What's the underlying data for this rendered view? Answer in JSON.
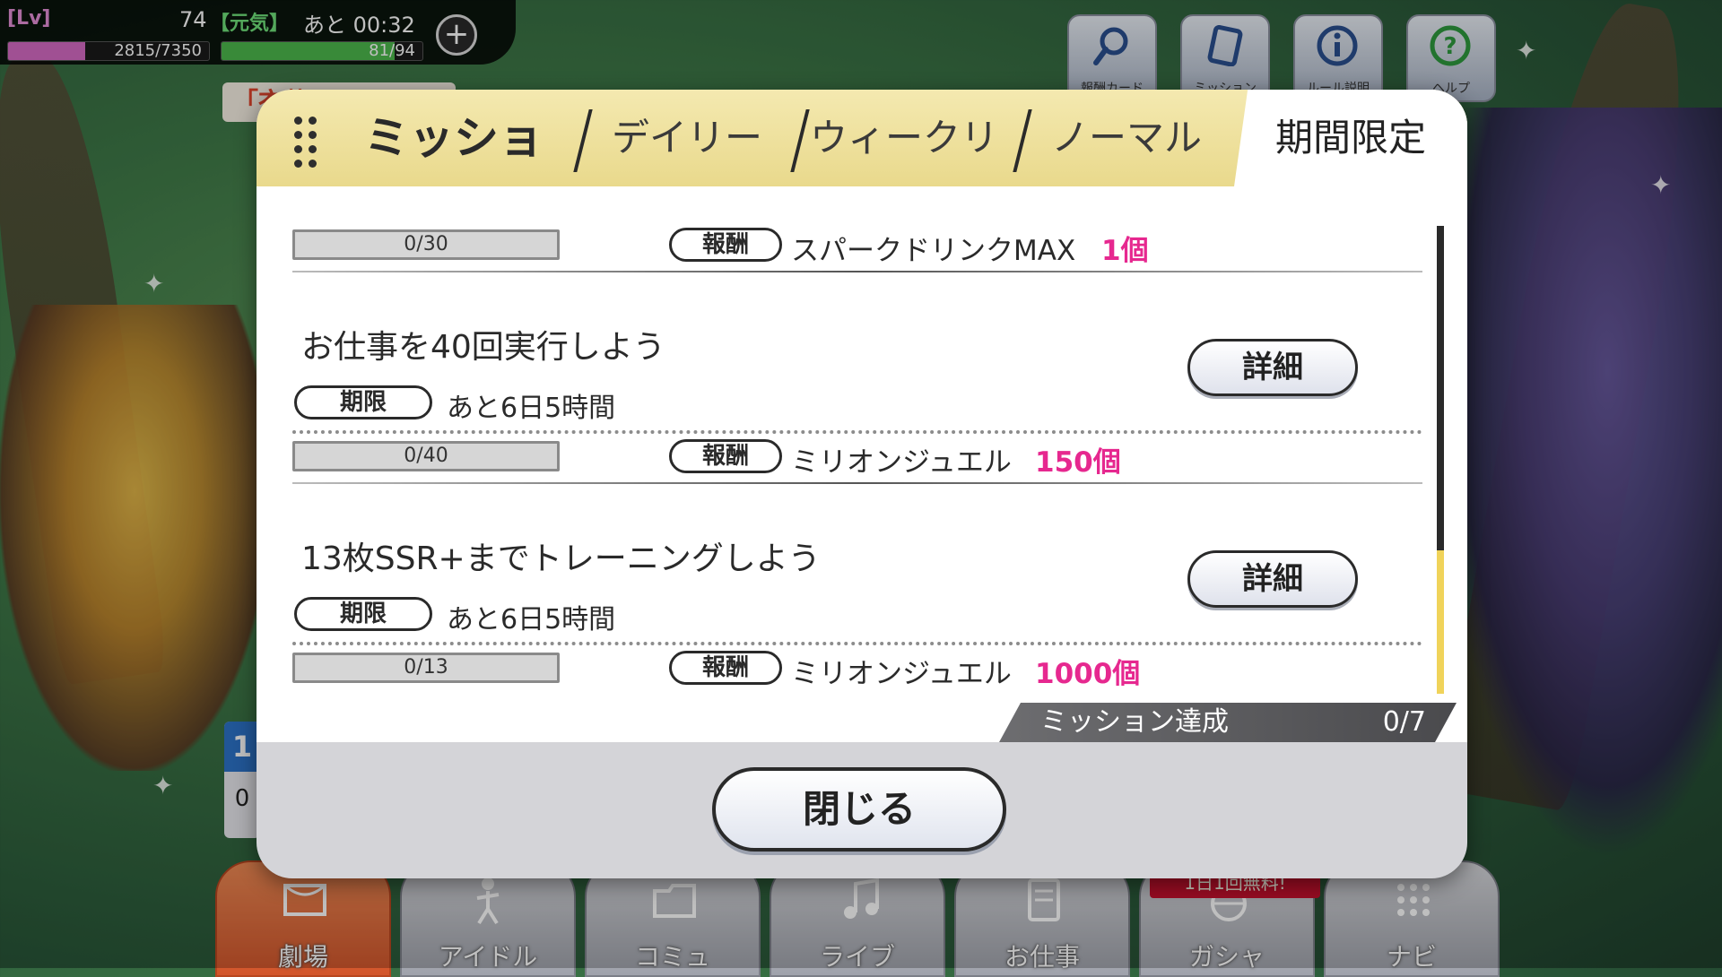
{
  "status_bar": {
    "lv_label": "[Lv]",
    "level": "74",
    "genki_label": "【元気】",
    "time_label": "あと 00:32",
    "exp_text": "2815/7350",
    "exp_fraction": 0.383,
    "stamina_text": "81/94",
    "stamina_fraction": 0.862,
    "colors": {
      "exp": "#d66bc4",
      "stamina": "#4cb84c"
    }
  },
  "top_buttons": [
    {
      "label": "報酬カード",
      "icon": "magnifier-icon"
    },
    {
      "label": "ミッション",
      "icon": "card-icon"
    },
    {
      "label": "ルール説明",
      "icon": "info-icon"
    },
    {
      "label": "ヘルプ",
      "icon": "help-icon"
    }
  ],
  "background": {
    "banner_text": "「衣装",
    "side_card_top": "1",
    "side_card_bottom": "0"
  },
  "modal": {
    "title": "ミッション",
    "tabs": [
      "デイリー",
      "ウィークリー",
      "ノーマル",
      "期間限定"
    ],
    "active_tab": "期間限定",
    "first_row": {
      "progress": "0/30",
      "reward_label": "報酬",
      "reward_name": "スパークドリンクMAX",
      "reward_qty": "1個"
    },
    "missions": [
      {
        "title": "お仕事を40回実行しよう",
        "deadline_label": "期限",
        "deadline": "あと6日5時間",
        "progress": "0/40",
        "reward_label": "報酬",
        "reward_name": "ミリオンジュエル",
        "reward_qty": "150個",
        "detail_label": "詳細"
      },
      {
        "title": "13枚SSR+までトレーニングしよう",
        "deadline_label": "期限",
        "deadline": "あと6日5時間",
        "progress": "0/13",
        "reward_label": "報酬",
        "reward_name": "ミリオンジュエル",
        "reward_qty": "1000個",
        "detail_label": "詳細"
      }
    ],
    "achievement_label": "ミッション達成",
    "achievement_value": "0/7",
    "close_label": "閉じる",
    "colors": {
      "accent": "#e6288f",
      "header": "#e9d98c",
      "scroll": "#f0d35a"
    }
  },
  "bottom_nav": {
    "items": [
      "劇場",
      "アイドル",
      "コミュ",
      "ライブ",
      "お仕事",
      "ガシャ",
      "ナビ"
    ],
    "active": "劇場",
    "gacha_badge": "1日1回無料!"
  }
}
